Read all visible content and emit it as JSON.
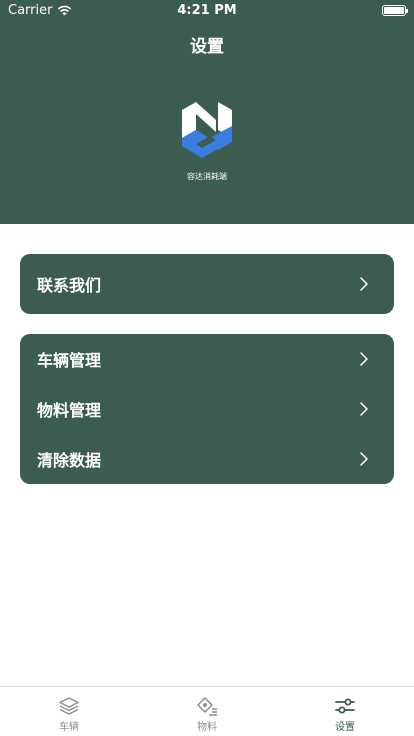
{
  "status_bar": {
    "carrier": "Carrier",
    "time": "4:21 PM"
  },
  "header": {
    "title": "设置",
    "app_name": "容达消耗端"
  },
  "menu": {
    "contact": "联系我们",
    "group": [
      {
        "label": "车辆管理"
      },
      {
        "label": "物料管理"
      },
      {
        "label": "清除数据"
      }
    ]
  },
  "tabbar": {
    "tabs": [
      {
        "label": "车辆",
        "icon": "layers-icon",
        "active": false
      },
      {
        "label": "物料",
        "icon": "materials-icon",
        "active": false
      },
      {
        "label": "设置",
        "icon": "sliders-icon",
        "active": true
      }
    ]
  },
  "colors": {
    "primary": "#3d5c50",
    "logo_blue": "#3a7de0",
    "inactive_tab": "#8e8e93"
  }
}
